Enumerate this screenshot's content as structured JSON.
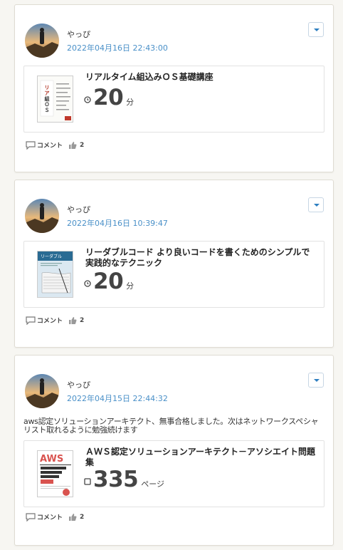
{
  "posts": [
    {
      "user": "やっぴ",
      "date": "2022年04月16日 22:43:00",
      "text": "",
      "book_title": "リアルタイム組込みＯＳ基礎講座",
      "stat_value": "20",
      "stat_unit": "分",
      "stat_icon": "clock-icon",
      "comment_label": "コメント",
      "like_count": "2",
      "cover": {
        "title": "リアルタイム組込みＯＳ",
        "bg": "#ffffff",
        "accent": "#c0392b"
      }
    },
    {
      "user": "やっぴ",
      "date": "2022年04月16日 10:39:47",
      "text": "",
      "book_title": "リーダブルコード より良いコードを書くためのシンプルで実践的なテクニック",
      "stat_value": "20",
      "stat_unit": "分",
      "stat_icon": "clock-icon",
      "comment_label": "コメント",
      "like_count": "2",
      "cover": {
        "title": "リーダブルコード",
        "bg": "#d7e6ef",
        "accent": "#2a6b93"
      }
    },
    {
      "user": "やっぴ",
      "date": "2022年04月15日 22:44:32",
      "text": "aws認定ソリューションアーキテクト、無事合格しました。次はネットワークスペシャリスト取れるように勉強続けます",
      "book_title": "ＡＷＳ認定ソリューションアーキテクト－アソシエイト問題集",
      "stat_value": "335",
      "stat_unit": "ページ",
      "stat_icon": "page-icon",
      "comment_label": "コメント",
      "like_count": "2",
      "cover": {
        "title": "AWS",
        "bg": "#ffffff",
        "accent": "#d9534f"
      }
    }
  ],
  "colors": {
    "accent": "#4a90c8",
    "text": "#333333"
  }
}
